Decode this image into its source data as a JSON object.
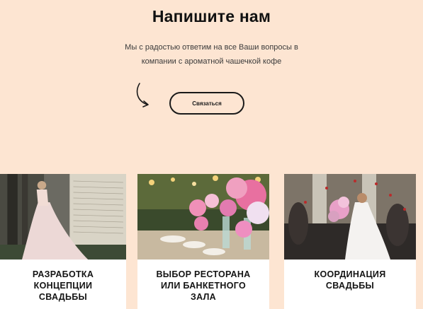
{
  "contact": {
    "title": "Напишите нам",
    "text_line1": "Мы с радостью ответим на все Ваши вопросы в",
    "text_line2": "компании с ароматной чашечкой кофе",
    "button_label": "Связаться"
  },
  "services": [
    {
      "title_line1": "РАЗРАБОТКА",
      "title_line2": "КОНЦЕПЦИИ",
      "title_line3": "СВАДЬБЫ"
    },
    {
      "title_line1": "ВЫБОР РЕСТОРАНА",
      "title_line2": "ИЛИ БАНКЕТНОГО",
      "title_line3": "ЗАЛА"
    },
    {
      "title_line1": "КООРДИНАЦИЯ",
      "title_line2": "СВАДЬБЫ",
      "title_line3": ""
    }
  ],
  "colors": {
    "background": "#fde5d2",
    "card": "#ffffff",
    "text": "#1a1a1a"
  }
}
